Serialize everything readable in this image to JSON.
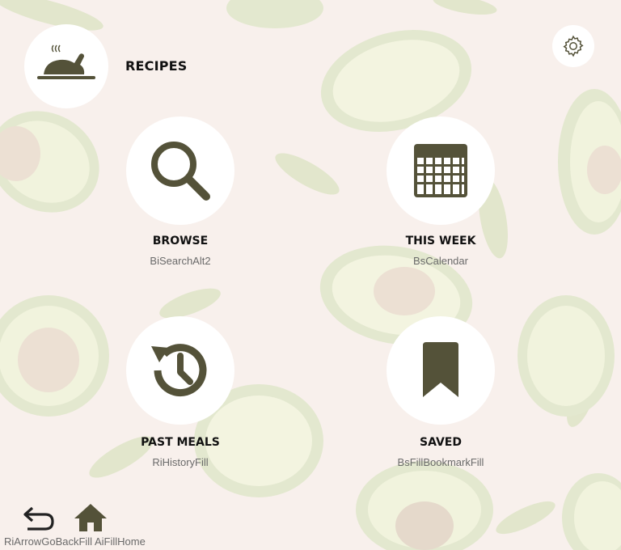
{
  "app": {
    "title": "RECIPES"
  },
  "colors": {
    "icon": "#545239",
    "background": "#f8f0ec",
    "circle": "#ffffff"
  },
  "icons": {
    "logo": "roast-chicken-icon",
    "settings": "gear-icon"
  },
  "tiles": [
    {
      "label": "BROWSE",
      "icon_name": "BiSearchAlt2"
    },
    {
      "label": "THIS WEEK",
      "icon_name": "BsCalendar"
    },
    {
      "label": "PAST MEALS",
      "icon_name": "RiHistoryFill"
    },
    {
      "label": "SAVED",
      "icon_name": "BsFillBookmarkFill"
    }
  ],
  "nav": {
    "back": {
      "icon_name": "RiArrowGoBackFill"
    },
    "home": {
      "icon_name": "AiFillHome"
    }
  }
}
